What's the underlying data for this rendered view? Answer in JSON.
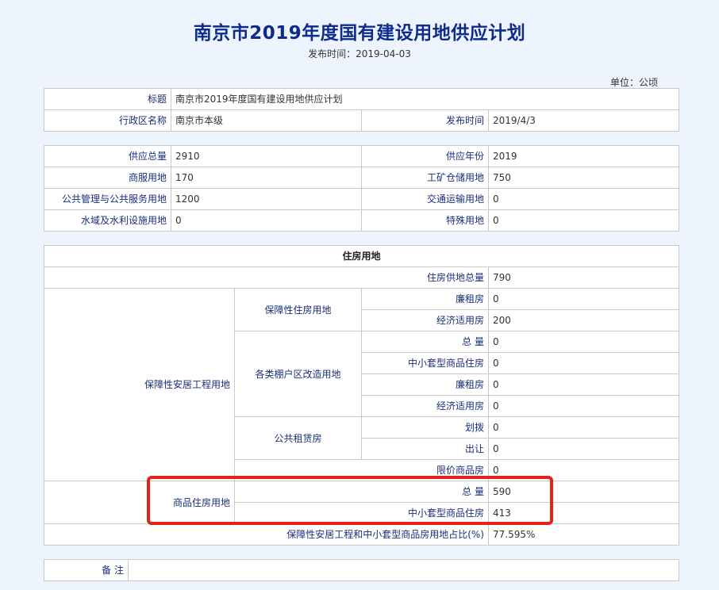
{
  "page": {
    "title": "南京市2019年度国有建设用地供应计划",
    "publish_line": "发布时间：2019-04-03",
    "unit": "单位：公顷"
  },
  "info": {
    "title_label": "标题",
    "title_value": "南京市2019年度国有建设用地供应计划",
    "region_label": "行政区名称",
    "region_value": "南京市本级",
    "date_label": "发布时间",
    "date_value": "2019/4/3"
  },
  "supply": {
    "total_label": "供应总量",
    "total_value": "2910",
    "year_label": "供应年份",
    "year_value": "2019",
    "commercial_label": "商服用地",
    "commercial_value": "170",
    "industrial_label": "工矿仓储用地",
    "industrial_value": "750",
    "public_label": "公共管理与公共服务用地",
    "public_value": "1200",
    "transport_label": "交通运输用地",
    "transport_value": "0",
    "water_label": "水域及水利设施用地",
    "water_value": "0",
    "special_label": "特殊用地",
    "special_value": "0"
  },
  "housing": {
    "header": "住房用地",
    "total_label": "住房供地总量",
    "total_value": "790",
    "affordable_project_label": "保障性安居工程用地",
    "affordable_housing_label": "保障性住房用地",
    "low_rent_label": "廉租房",
    "low_rent_value": "0",
    "economic_label": "经济适用房",
    "economic_value": "200",
    "shanty_label": "各类棚户区改造用地",
    "shanty_total_label": "总 量",
    "shanty_total_value": "0",
    "shanty_small_label": "中小套型商品住房",
    "shanty_small_value": "0",
    "shanty_low_rent_label": "廉租房",
    "shanty_low_rent_value": "0",
    "shanty_economic_label": "经济适用房",
    "shanty_economic_value": "0",
    "public_rental_label": "公共租赁房",
    "allocation_label": "划拨",
    "allocation_value": "0",
    "transfer_label": "出让",
    "transfer_value": "0",
    "price_limited_label": "限价商品房",
    "price_limited_value": "0",
    "commercial_label": "商品住房用地",
    "commercial_total_label": "总 量",
    "commercial_total_value": "590",
    "commercial_small_label": "中小套型商品住房",
    "commercial_small_value": "413",
    "ratio_label": "保障性安居工程和中小套型商品房用地占比(%)",
    "ratio_value": "77.595%"
  },
  "remarks": {
    "label": "备 注",
    "value": ""
  },
  "colors": {
    "background": "#eef4fd",
    "title": "#0d2c8c",
    "label": "#1b2f7a",
    "highlight": "#e4221a"
  }
}
